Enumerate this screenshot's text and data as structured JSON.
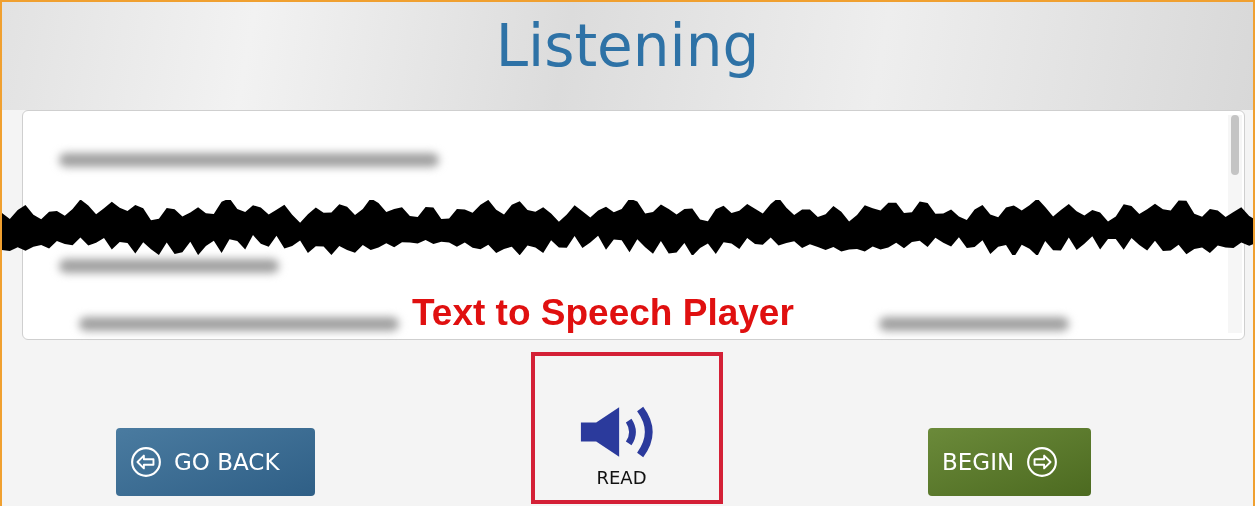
{
  "title": "Listening",
  "annotation": {
    "label": "Text to Speech Player"
  },
  "read_button": {
    "label": "READ"
  },
  "buttons": [
    {
      "label": "GO BACK",
      "kind": "back"
    },
    {
      "label": "BEGIN",
      "kind": "next"
    }
  ]
}
